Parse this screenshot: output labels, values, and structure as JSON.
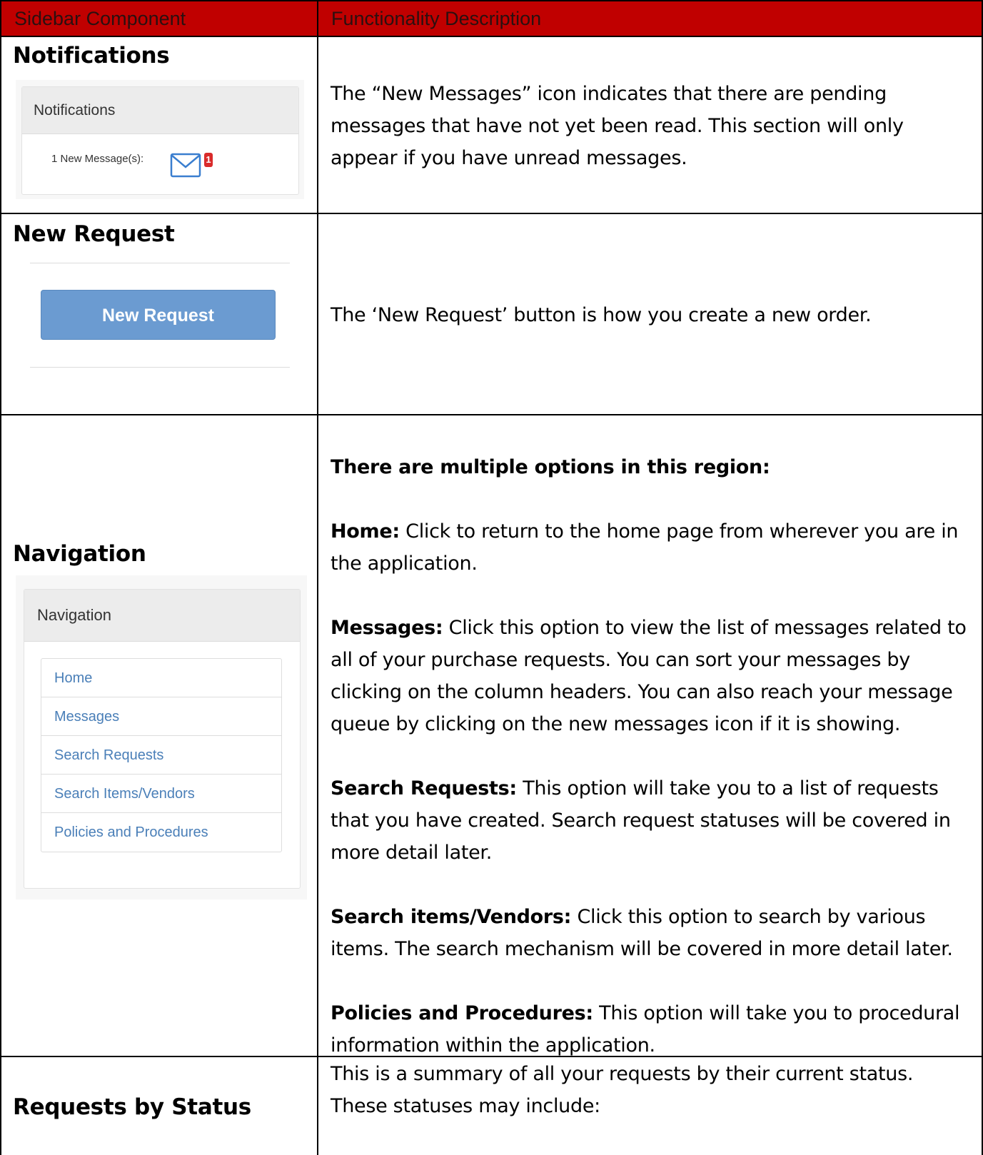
{
  "header": {
    "col1": "Sidebar Component",
    "col2": "Functionality Description"
  },
  "notifications": {
    "title": "Notifications",
    "panel_title": "Notifications",
    "message_label": "1 New Message(s):",
    "badge_count": "1",
    "description": "The “New Messages” icon indicates that there are pending messages that have not yet been read. This section will only appear if you have unread messages."
  },
  "new_request": {
    "title": "New Request",
    "button_label": "New Request",
    "description": "The ‘New Request’ button is how you create a new order."
  },
  "navigation": {
    "title": "Navigation",
    "panel_title": "Navigation",
    "items": [
      {
        "label": "Home"
      },
      {
        "label": "Messages"
      },
      {
        "label": "Search Requests"
      },
      {
        "label": "Search Items/Vendors"
      },
      {
        "label": "Policies and Procedures"
      }
    ],
    "intro": "There are multiple options in this region:",
    "entries": [
      {
        "term": "Home:",
        "text": " Click to return to the home page from wherever you are in the application."
      },
      {
        "term": "Messages:",
        "text": " Click this option to view the list of messages related to all of your purchase requests. You can sort your messages by clicking on the column headers. You can also reach your message queue by clicking on the new messages icon if it is showing."
      },
      {
        "term": "Search Requests:",
        "text": " This option will take you to a list of requests that you have created. Search request statuses will be covered in more detail later."
      },
      {
        "term": "Search items/Vendors:",
        "text": " Click this option to search by various items. The search mechanism will be covered in more detail later."
      },
      {
        "term": "Policies and Procedures:",
        "text": " This option will take you to procedural information within the application."
      }
    ]
  },
  "requests_by_status": {
    "title": "Requests by Status",
    "description": "This is a summary of all your requests by their current status. These statuses may include:"
  }
}
